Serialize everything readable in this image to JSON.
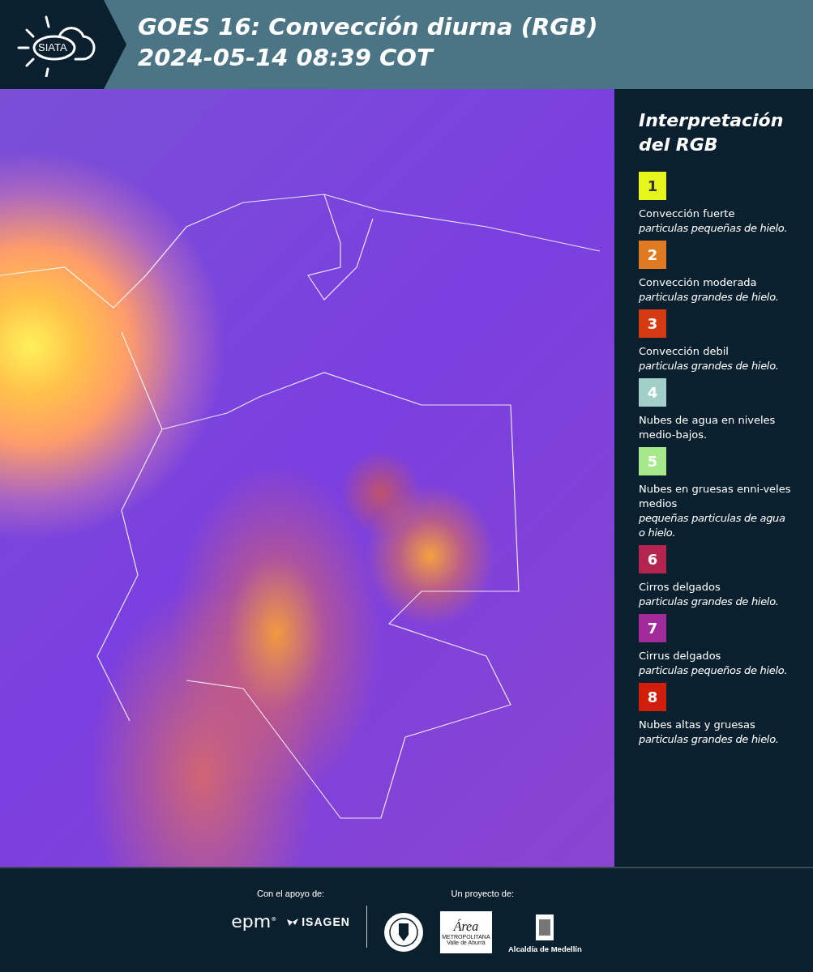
{
  "header": {
    "logo_text": "SIATA",
    "title": "GOES 16: Convección diurna (RGB)",
    "subtitle": "2024-05-14 08:39 COT"
  },
  "legend": {
    "title": "Interpretación del RGB",
    "items": [
      {
        "number": "1",
        "color": "#e8f51d",
        "dark_text": true,
        "label": "Convección fuerte",
        "note": "particulas pequeñas de hielo."
      },
      {
        "number": "2",
        "color": "#e07a22",
        "dark_text": false,
        "label": "Convección moderada",
        "note": "particulas grandes de hielo."
      },
      {
        "number": "3",
        "color": "#d63a12",
        "dark_text": false,
        "label": "Convección debil",
        "note": "particulas grandes de hielo."
      },
      {
        "number": "4",
        "color": "#a3cfc9",
        "dark_text": false,
        "label": "Nubes de agua en niveles medio-bajos."
      },
      {
        "number": "5",
        "color": "#a6e88a",
        "dark_text": false,
        "label": "Nubes en gruesas enni-veles medios",
        "note": "pequeñas particulas de agua o hielo."
      },
      {
        "number": "6",
        "color": "#b3254e",
        "dark_text": false,
        "label": "Cirros delgados",
        "note": "particulas grandes de hielo."
      },
      {
        "number": "7",
        "color": "#a22a9a",
        "dark_text": false,
        "label": "Cirrus delgados",
        "note": "particulas pequeños de hielo."
      },
      {
        "number": "8",
        "color": "#d01e0a",
        "dark_text": false,
        "label": "Nubes altas y gruesas",
        "note": "particulas grandes de hielo."
      }
    ]
  },
  "footer": {
    "support_label": "Con el apoyo de:",
    "project_label": "Un proyecto de:",
    "epm": "epm$^{®}$",
    "isagen": "ISAGEN",
    "area": "Área",
    "area_sub": "METROPOLITANA",
    "area_sub2": "Valle de Aburrá",
    "alcaldia": "Alcaldía de Medellín"
  }
}
